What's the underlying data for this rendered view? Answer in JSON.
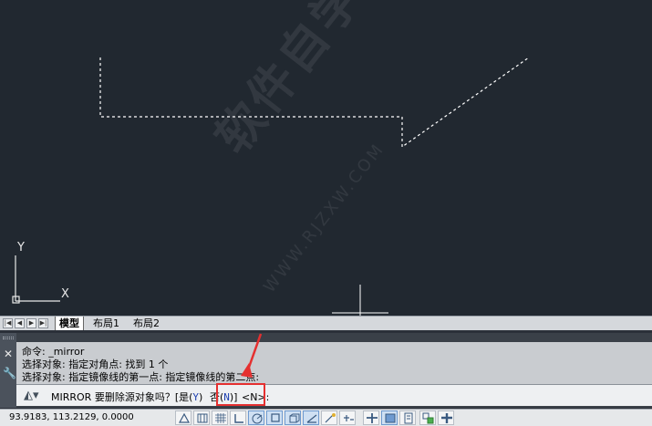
{
  "watermark": {
    "main": "软件自学网",
    "sub": "WWW.RJZXW.COM"
  },
  "ucs": {
    "x_label": "X",
    "y_label": "Y"
  },
  "tabs": {
    "nav": [
      "|◀",
      "◀",
      "▶",
      "▶|"
    ],
    "items": [
      {
        "label": "模型",
        "active": true
      },
      {
        "label": "布局1",
        "active": false
      },
      {
        "label": "布局2",
        "active": false
      }
    ]
  },
  "command": {
    "history": [
      "命令: _mirror",
      "选择对象: 指定对角点: 找到 1 个",
      "选择对象:  指定镜像线的第一点: 指定镜像线的第二点:"
    ],
    "prompt_prefix": "MIRROR 要删除源对象吗？[",
    "option_yes_label": "是(",
    "option_yes_key": "Y",
    "option_yes_close": ")",
    "option_no_label": "否(",
    "option_no_key": "N",
    "option_no_close": ")]",
    "prompt_suffix": " <N>:"
  },
  "status": {
    "coords": "93.9183,  113.2129, 0.0000"
  },
  "colors": {
    "canvas": "#212830",
    "highlight": "#e53030",
    "option": "#1c3fb0"
  }
}
